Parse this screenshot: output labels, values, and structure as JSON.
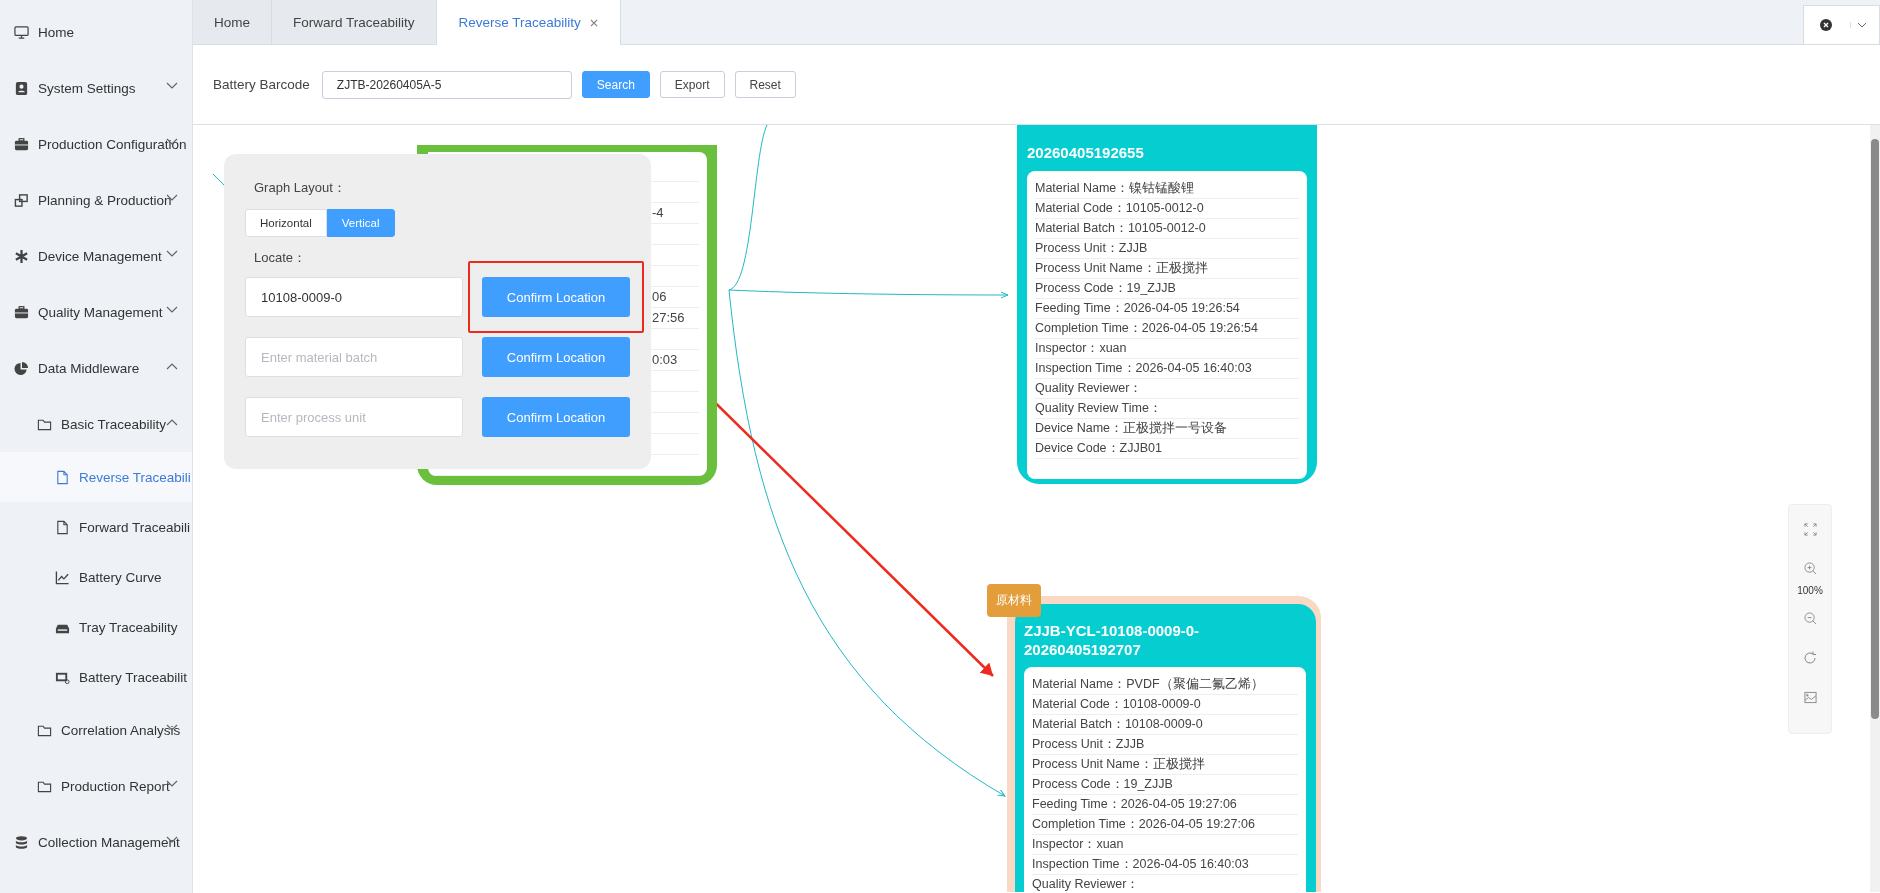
{
  "sidebar": {
    "items": [
      {
        "label": "Home"
      },
      {
        "label": "System Settings",
        "expanded": false
      },
      {
        "label": "Production Configuration",
        "expanded": false
      },
      {
        "label": "Planning & Production",
        "expanded": false
      },
      {
        "label": "Device Management",
        "expanded": false
      },
      {
        "label": "Quality Management",
        "expanded": false
      },
      {
        "label": "Data Middleware",
        "expanded": true,
        "children": [
          {
            "label": "Basic Traceability",
            "expanded": true,
            "children": [
              {
                "label": "Reverse Traceabili",
                "selected": true
              },
              {
                "label": "Forward Traceabili",
                "selected": false
              },
              {
                "label": "Battery Curve",
                "selected": false
              },
              {
                "label": "Tray Traceability",
                "selected": false
              },
              {
                "label": "Battery Traceabilit",
                "selected": false
              }
            ]
          },
          {
            "label": "Correlation Analysis",
            "expanded": false
          },
          {
            "label": "Production Report",
            "expanded": false
          }
        ]
      },
      {
        "label": "Collection Management",
        "expanded": false
      }
    ]
  },
  "tabs": [
    {
      "label": "Home",
      "selected": false,
      "closable": false
    },
    {
      "label": "Forward Traceability",
      "selected": false,
      "closable": false
    },
    {
      "label": "Reverse Traceability",
      "selected": true,
      "closable": true
    }
  ],
  "toolbar": {
    "label": "Battery Barcode",
    "barcode": {
      "value": "ZJTB-20260405A-5"
    },
    "buttons": [
      {
        "label": "Search",
        "kind": "primary"
      },
      {
        "label": "Export",
        "kind": "default"
      },
      {
        "label": "Reset",
        "kind": "default"
      }
    ]
  },
  "layout_panel": {
    "title": "Graph Layout：",
    "options": [
      {
        "label": "Horizontal",
        "selected": false
      },
      {
        "label": "Vertical",
        "selected": true
      }
    ],
    "locate_label": "Locate：",
    "locate_rows": [
      {
        "value": "10108-0009-0",
        "button": "Confirm Location",
        "highlighted": true
      },
      {
        "placeholder": "Enter material batch",
        "button": "Confirm Location",
        "highlighted": false
      },
      {
        "placeholder": "Enter process unit",
        "button": "Confirm Location",
        "highlighted": false
      }
    ]
  },
  "graph": {
    "nodes": [
      {
        "color": "#6abf3c",
        "highlighted": false,
        "fragments": [
          "-4",
          "06",
          "27:56",
          "0:03"
        ]
      },
      {
        "color": "#06cdd0",
        "highlighted": false,
        "title": "20260405192655",
        "rows": [
          "Material Name：镍钴锰酸锂",
          "Material Code：10105-0012-0",
          "Material Batch：10105-0012-0",
          "Process Unit：ZJJB",
          "Process Unit Name：正极搅拌",
          "Process Code：19_ZJJB",
          "Feeding Time：2026-04-05 19:26:54",
          "Completion Time：2026-04-05 19:26:54",
          "Inspector：xuan",
          "Inspection Time：2026-04-05 16:40:03",
          "Quality Reviewer：",
          "Quality Review Time：",
          "Device Name：正极搅拌一号设备",
          "Device Code：ZJJB01"
        ]
      },
      {
        "color": "#06cdd0",
        "highlighted": true,
        "badge": "原材料",
        "title": "ZJJB-YCL-10108-0009-0-20260405192707",
        "rows": [
          "Material Name：PVDF（聚偏二氟乙烯）",
          "Material Code：10108-0009-0",
          "Material Batch：10108-0009-0",
          "Process Unit：ZJJB",
          "Process Unit Name：正极搅拌",
          "Process Code：19_ZJJB",
          "Feeding Time：2026-04-05 19:27:06",
          "Completion Time：2026-04-05 19:27:06",
          "Inspector：xuan",
          "Inspection Time：2026-04-05 16:40:03",
          "Quality Reviewer："
        ]
      }
    ]
  },
  "zoom_tools": {
    "zoom": "100%"
  }
}
